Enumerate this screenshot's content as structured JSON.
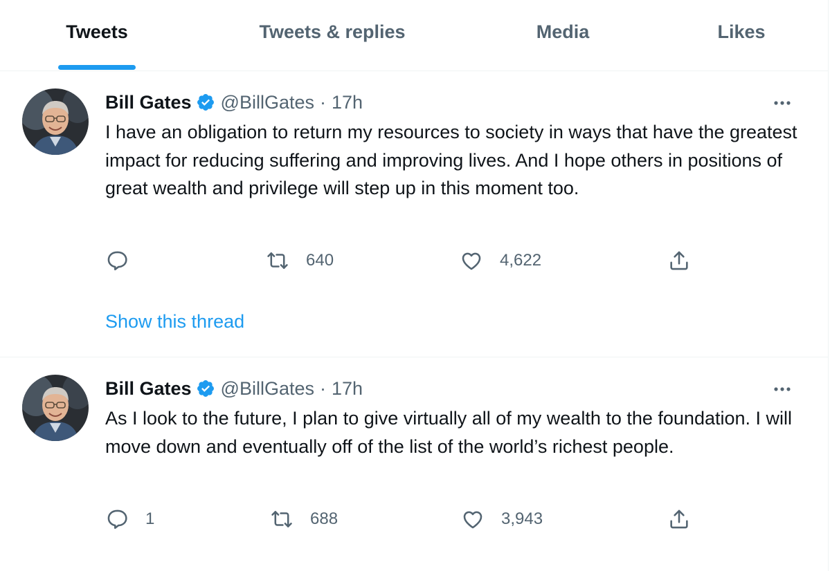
{
  "colors": {
    "accent": "#1d9bf0",
    "text_primary": "#0f1419",
    "text_secondary": "#536471",
    "divider": "#eff3f4"
  },
  "tabs": [
    {
      "label": "Tweets",
      "active": true
    },
    {
      "label": "Tweets & replies",
      "active": false
    },
    {
      "label": "Media",
      "active": false
    },
    {
      "label": "Likes",
      "active": false
    }
  ],
  "tweets": [
    {
      "name": "Bill Gates",
      "verified_icon": "verified-badge-icon",
      "handle": "@BillGates",
      "separator": "·",
      "time": "17h",
      "text": "I have an obligation to return my resources to society in ways that have the greatest impact for reducing suffering and improving lives. And I hope others in positions of great wealth and privilege will step up in this moment too.",
      "replies": "",
      "retweets": "640",
      "likes": "4,622",
      "show_thread": "Show this thread"
    },
    {
      "name": "Bill Gates",
      "verified_icon": "verified-badge-icon",
      "handle": "@BillGates",
      "separator": "·",
      "time": "17h",
      "text": "As I look to the future, I plan to give virtually all of my wealth to the foundation. I will move down and eventually off of the list of the world’s richest people.",
      "replies": "1",
      "retweets": "688",
      "likes": "3,943"
    }
  ]
}
